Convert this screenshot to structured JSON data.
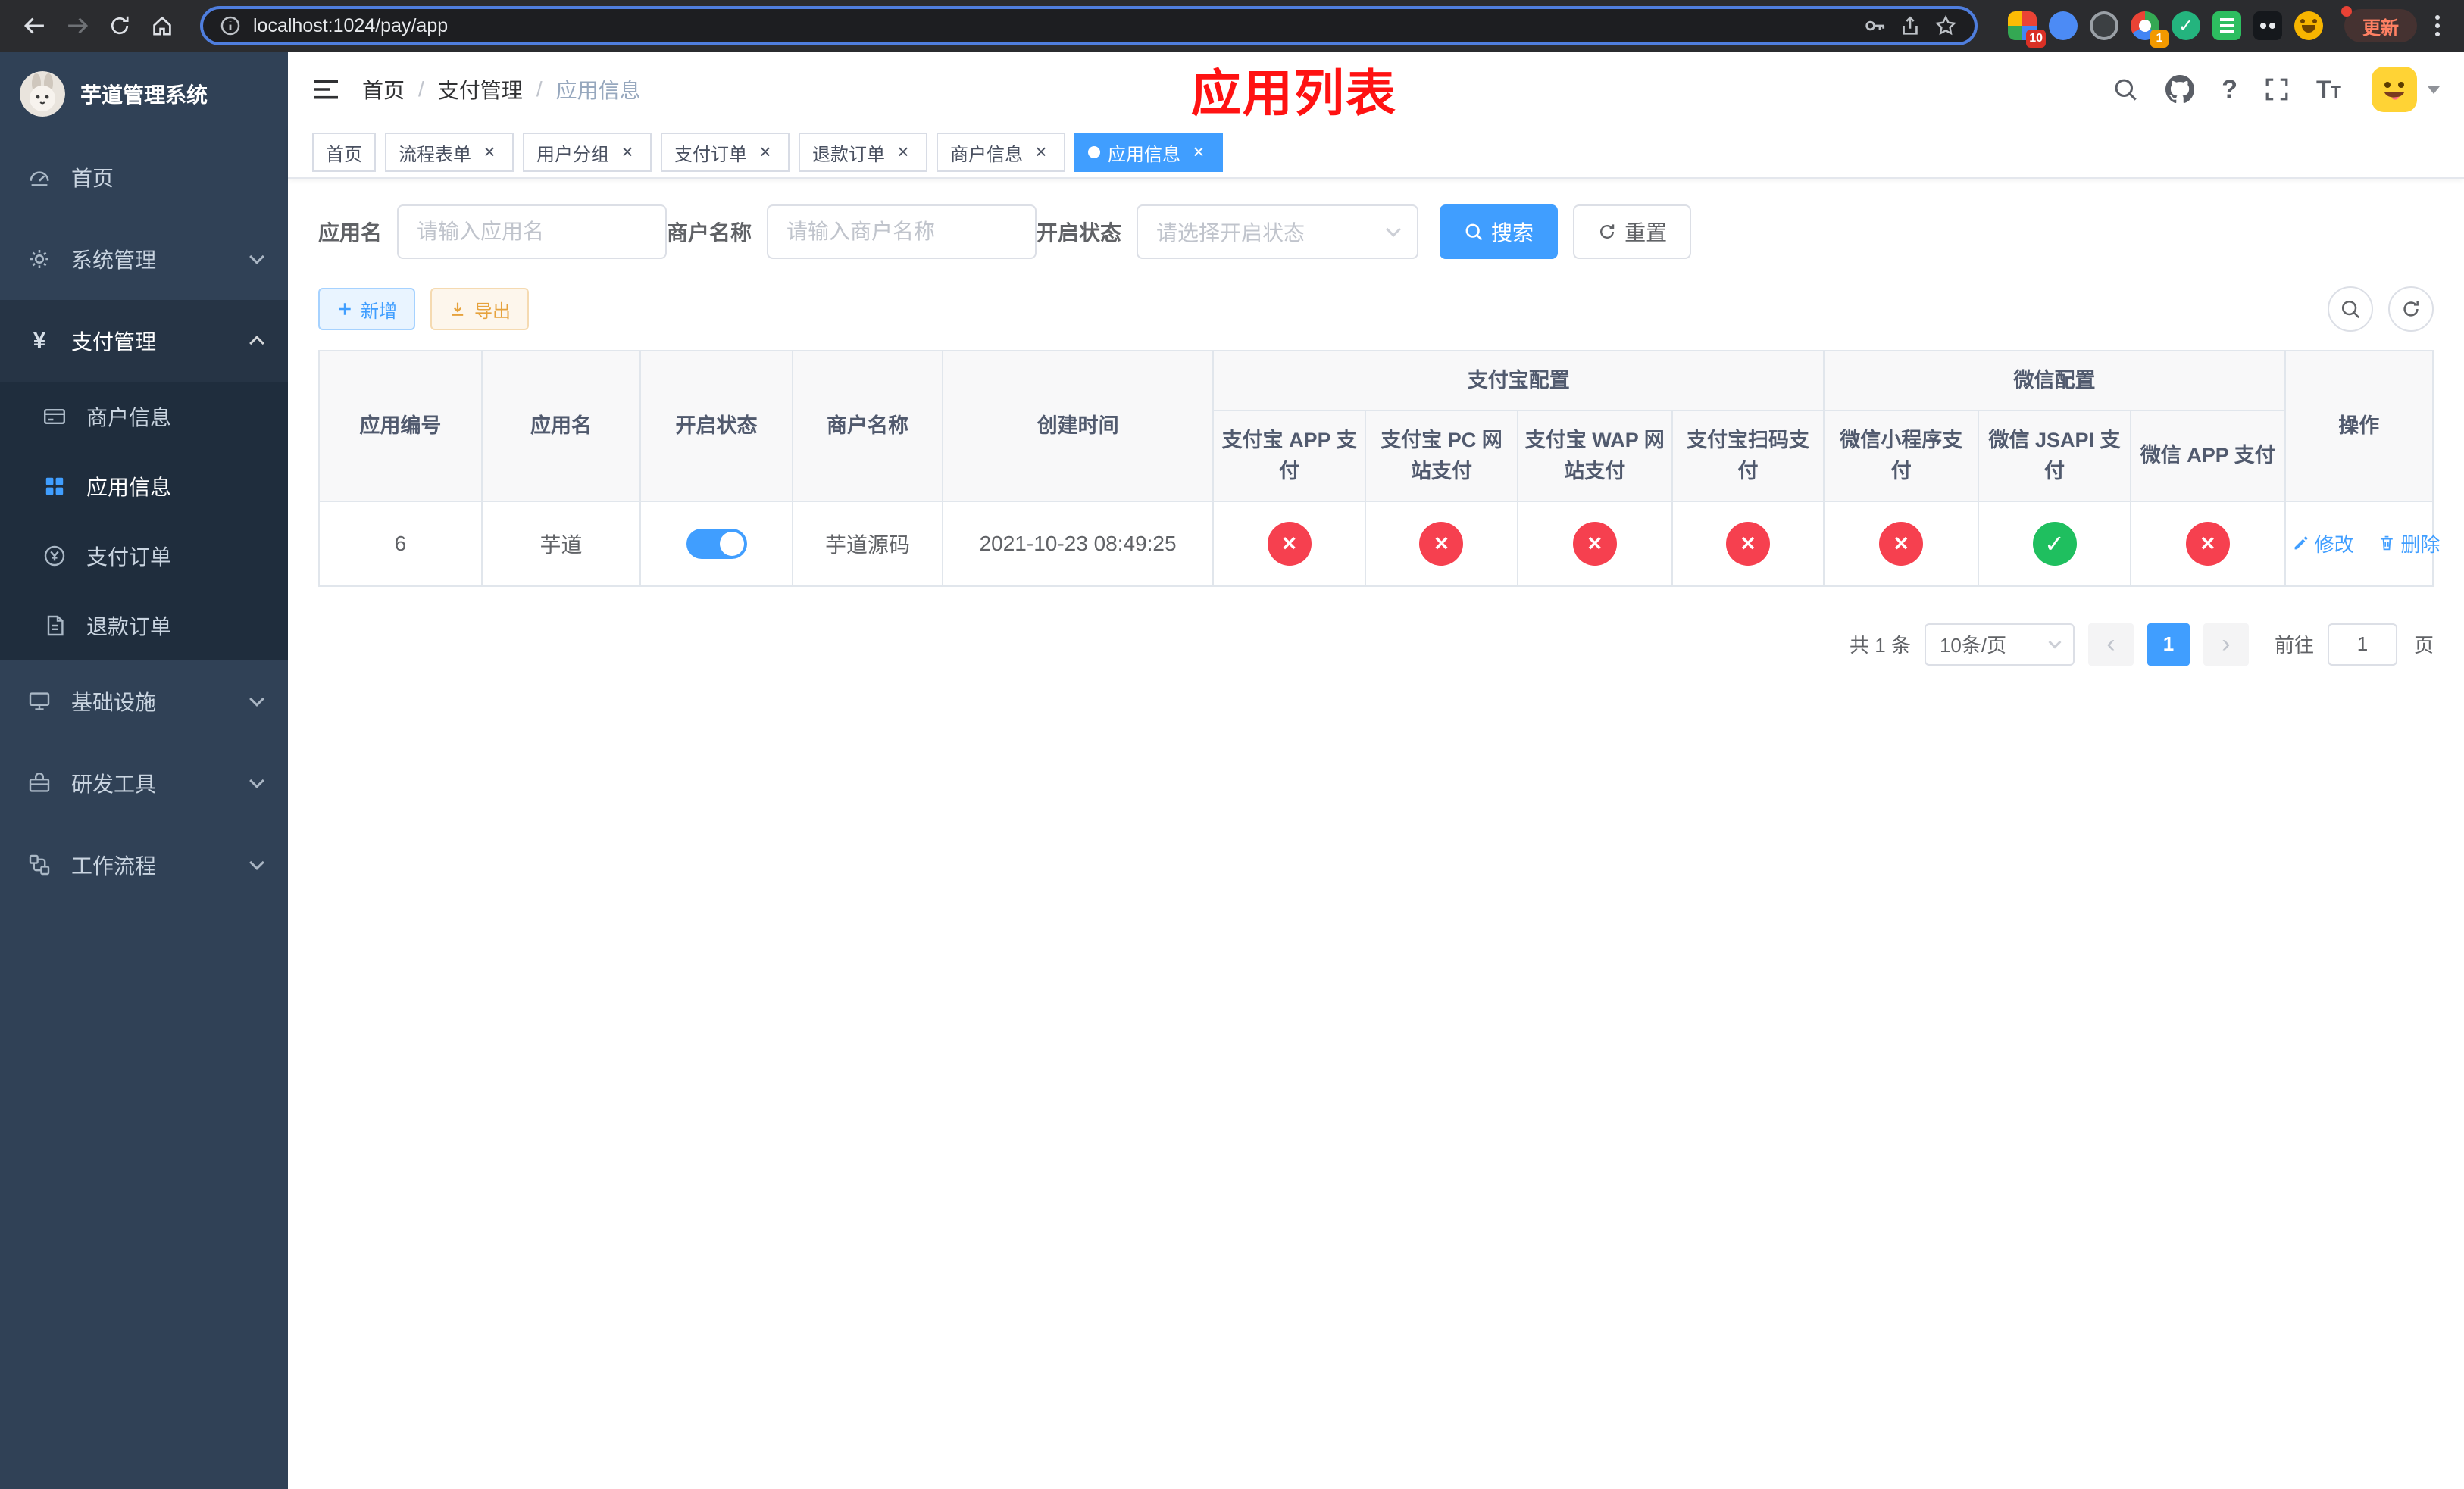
{
  "browser": {
    "url": "localhost:1024/pay/app",
    "update_label": "更新",
    "grid_badge": "10",
    "recorder_badge": "1"
  },
  "sidebar": {
    "title": "芋道管理系统",
    "items": [
      {
        "label": "首页"
      },
      {
        "label": "系统管理"
      },
      {
        "label": "支付管理",
        "children": [
          {
            "label": "商户信息"
          },
          {
            "label": "应用信息"
          },
          {
            "label": "支付订单"
          },
          {
            "label": "退款订单"
          }
        ]
      },
      {
        "label": "基础设施"
      },
      {
        "label": "研发工具"
      },
      {
        "label": "工作流程"
      }
    ]
  },
  "navbar": {
    "breadcrumb": [
      "首页",
      "支付管理",
      "应用信息"
    ],
    "annotation": "应用列表"
  },
  "tags": [
    {
      "label": "首页"
    },
    {
      "label": "流程表单"
    },
    {
      "label": "用户分组"
    },
    {
      "label": "支付订单"
    },
    {
      "label": "退款订单"
    },
    {
      "label": "商户信息"
    },
    {
      "label": "应用信息"
    }
  ],
  "filters": {
    "app_name_label": "应用名",
    "app_name_placeholder": "请输入应用名",
    "merchant_label": "商户名称",
    "merchant_placeholder": "请输入商户名称",
    "status_label": "开启状态",
    "status_placeholder": "请选择开启状态",
    "search_label": "搜索",
    "reset_label": "重置"
  },
  "toolbar": {
    "add": "新增",
    "export": "导出"
  },
  "table": {
    "headers": {
      "app_id": "应用编号",
      "app_name": "应用名",
      "status": "开启状态",
      "merchant": "商户名称",
      "created": "创建时间",
      "alipay_group": "支付宝配置",
      "wechat_group": "微信配置",
      "alipay_app": "支付宝 APP 支付",
      "alipay_pc": "支付宝 PC 网站支付",
      "alipay_wap": "支付宝 WAP 网站支付",
      "alipay_qr": "支付宝扫码支付",
      "wx_mini": "微信小程序支付",
      "wx_jsapi": "微信 JSAPI 支付",
      "wx_app": "微信 APP 支付",
      "op": "操作"
    },
    "rows": [
      {
        "id": "6",
        "name": "芋道",
        "enabled": true,
        "merchant": "芋道源码",
        "created": "2021-10-23 08:49:25",
        "alipay_app": "no",
        "alipay_pc": "no",
        "alipay_wap": "no",
        "alipay_qr": "no",
        "wx_mini": "no",
        "wx_jsapi": "yes",
        "wx_app": "no",
        "edit": "修改",
        "del": "删除"
      }
    ]
  },
  "pagination": {
    "total": "共 1 条",
    "size": "10条/页",
    "page": "1",
    "goto": "前往",
    "goto_value": "1",
    "unit": "页"
  },
  "colors": {
    "primary": "#409eff",
    "danger": "#f6404f",
    "success": "#1fbf5f",
    "warning": "#e6a23c",
    "sidebar_bg": "#304156",
    "submenu_bg": "#1f2d3d",
    "annotation_red": "#ff1212"
  }
}
